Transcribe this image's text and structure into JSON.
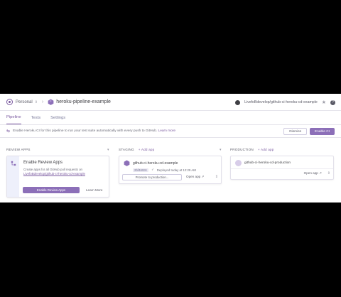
{
  "header": {
    "account": "Personal",
    "pipeline_name": "heroku-pipeline-example",
    "repo": "LivefoBdevelop/github-ci-heroku-cd-example"
  },
  "tabs": [
    "Pipeline",
    "Tests",
    "Settings"
  ],
  "banner": {
    "message_prefix": "Enable Heroku CI for this pipeline to run your test suite automatically with every push to GitHub.",
    "message_link": "Learn more",
    "dismiss_label": "Dismiss",
    "enable_label": "Enable CI"
  },
  "columns": {
    "review": {
      "header": "REVIEW APPS",
      "card_title": "Enable Review Apps",
      "desc_line1": "Create apps for all GitHub pull requests on",
      "desc_link": "LivefoBdevelop/github-ci-heroku-cd-example",
      "enable_label": "Enable Review Apps",
      "learn_more": "Learn More"
    },
    "staging": {
      "header": "STAGING",
      "add_label": "Add app",
      "app_name": "github-ci-heroku-cd-example",
      "hash": "2bf4693c",
      "deployed": "Deployed today at 12:29 AM",
      "promote_label": "Promote to production...",
      "open_label": "Open app"
    },
    "production": {
      "header": "PRODUCTION",
      "add_label": "Add app",
      "app_name": "github-ci-heroku-cd-production",
      "open_label": "Open app"
    }
  },
  "colors": {
    "accent": "#79589f",
    "button": "#8c6fb8",
    "review_side": "#eef0fb"
  }
}
